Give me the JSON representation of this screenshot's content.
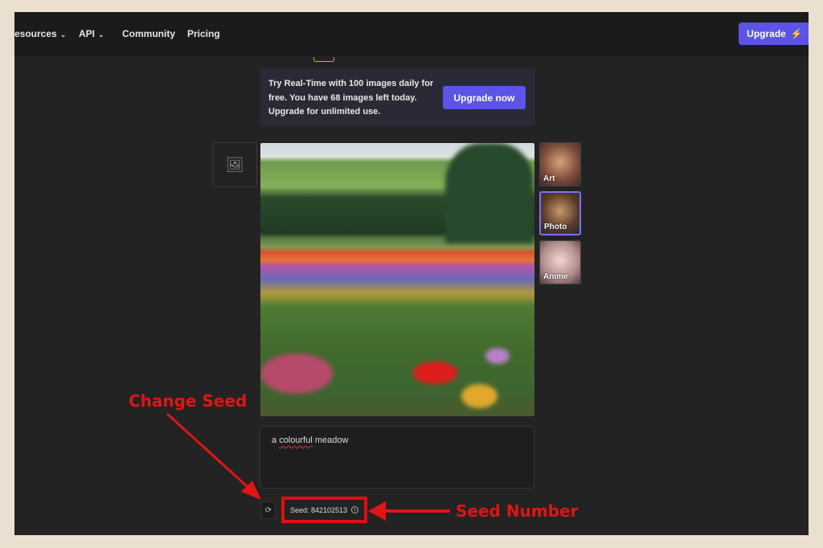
{
  "nav": {
    "items": [
      {
        "label": "esources",
        "dropdown": true
      },
      {
        "label": "API",
        "dropdown": true
      },
      {
        "label": "Community",
        "dropdown": false
      },
      {
        "label": "Pricing",
        "dropdown": false
      }
    ],
    "upgrade_label": "Upgrade",
    "upgrade_icon": "lightning-icon"
  },
  "banner": {
    "text": "Try Real-Time with 100 images daily for free. You have 68 images left today. Upgrade for unlimited use.",
    "button": "Upgrade now"
  },
  "styles": [
    {
      "label": "Art",
      "selected": false
    },
    {
      "label": "Photo",
      "selected": true
    },
    {
      "label": "Anime",
      "selected": false
    }
  ],
  "prompt": {
    "pre": "a ",
    "misspelled": "colourful",
    "post": " meadow"
  },
  "seed": {
    "label": "Seed: 842102513"
  },
  "annotations": {
    "change_seed": "Change Seed",
    "seed_number": "Seed Number"
  },
  "colors": {
    "accent": "#5b54e6",
    "annotation": "#e01515"
  }
}
